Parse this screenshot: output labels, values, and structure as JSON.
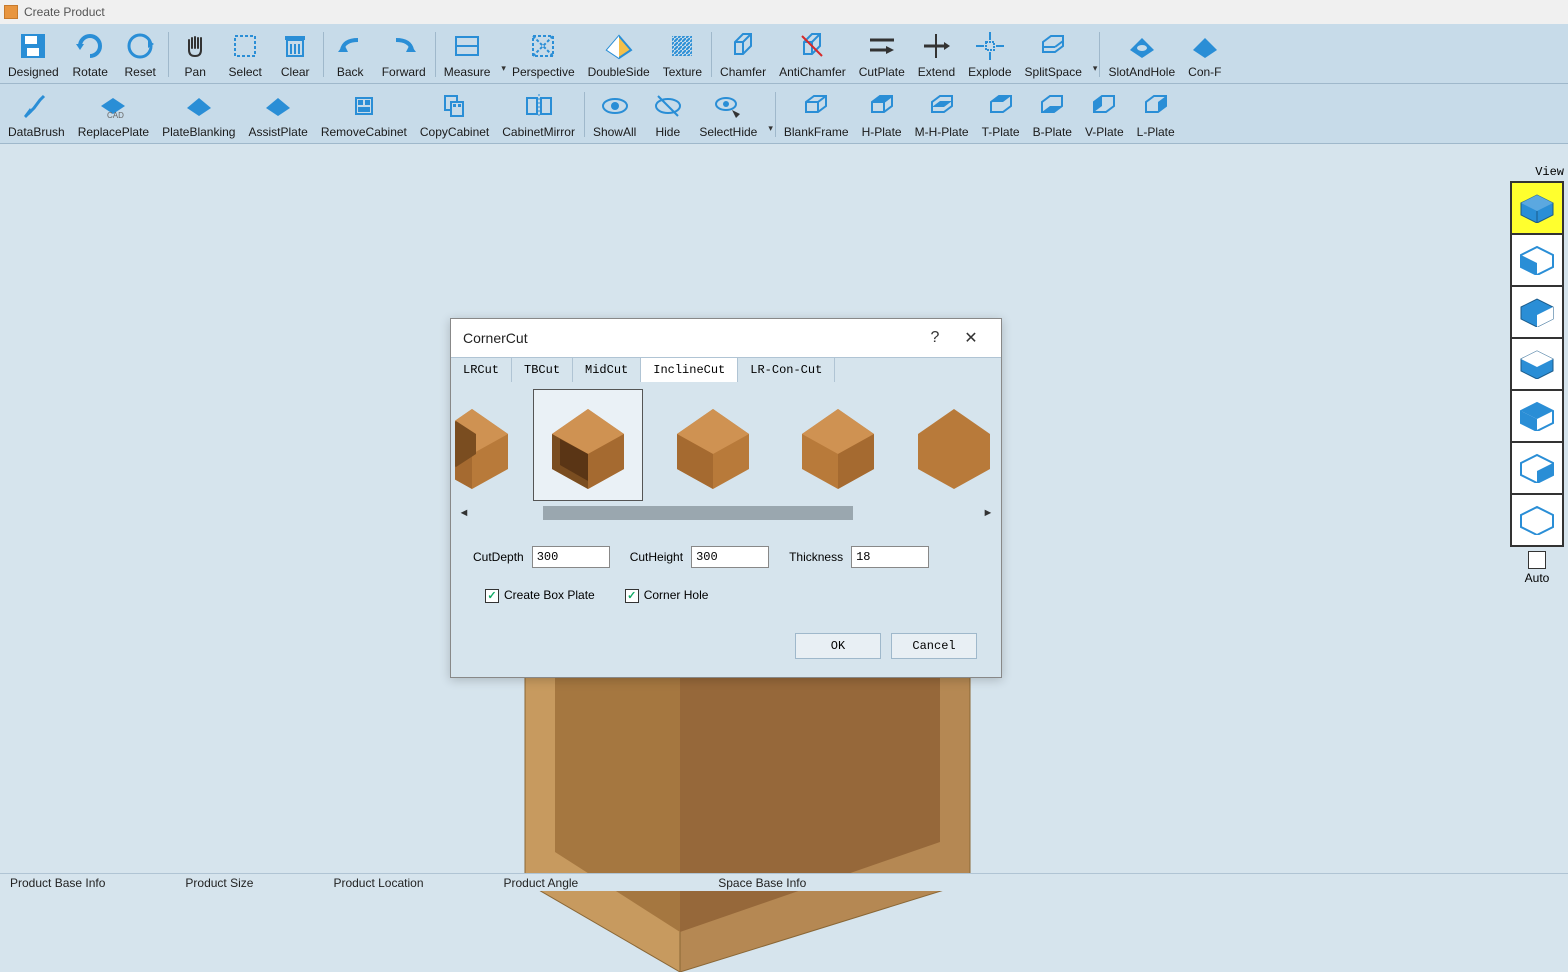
{
  "window": {
    "title": "Create Product"
  },
  "toolbar1": {
    "items": [
      {
        "name": "designed",
        "label": "Designed"
      },
      {
        "name": "rotate",
        "label": "Rotate"
      },
      {
        "name": "reset",
        "label": "Reset"
      },
      {
        "name": "pan",
        "label": "Pan"
      },
      {
        "name": "select",
        "label": "Select"
      },
      {
        "name": "clear",
        "label": "Clear"
      },
      {
        "name": "back",
        "label": "Back"
      },
      {
        "name": "forward",
        "label": "Forward"
      },
      {
        "name": "measure",
        "label": "Measure"
      },
      {
        "name": "perspective",
        "label": "Perspective"
      },
      {
        "name": "doubleside",
        "label": "DoubleSide"
      },
      {
        "name": "texture",
        "label": "Texture"
      },
      {
        "name": "chamfer",
        "label": "Chamfer"
      },
      {
        "name": "antichamfer",
        "label": "AntiChamfer"
      },
      {
        "name": "cutplate",
        "label": "CutPlate"
      },
      {
        "name": "extend",
        "label": "Extend"
      },
      {
        "name": "explode",
        "label": "Explode"
      },
      {
        "name": "splitspace",
        "label": "SplitSpace"
      },
      {
        "name": "slotandhole",
        "label": "SlotAndHole"
      },
      {
        "name": "conf",
        "label": "Con-F"
      }
    ]
  },
  "toolbar2": {
    "items": [
      {
        "name": "databrush",
        "label": "DataBrush"
      },
      {
        "name": "replaceplate",
        "label": "ReplacePlate"
      },
      {
        "name": "plateblanking",
        "label": "PlateBlanking"
      },
      {
        "name": "assistplate",
        "label": "AssistPlate"
      },
      {
        "name": "removecabinet",
        "label": "RemoveCabinet"
      },
      {
        "name": "copycabinet",
        "label": "CopyCabinet"
      },
      {
        "name": "cabinetmirror",
        "label": "CabinetMirror"
      },
      {
        "name": "showall",
        "label": "ShowAll"
      },
      {
        "name": "hide",
        "label": "Hide"
      },
      {
        "name": "selecthide",
        "label": "SelectHide"
      },
      {
        "name": "blankframe",
        "label": "BlankFrame"
      },
      {
        "name": "hplate",
        "label": "H-Plate"
      },
      {
        "name": "mhplate",
        "label": "M-H-Plate"
      },
      {
        "name": "tplate",
        "label": "T-Plate"
      },
      {
        "name": "bplate",
        "label": "B-Plate"
      },
      {
        "name": "vplate",
        "label": "V-Plate"
      },
      {
        "name": "lplate",
        "label": "L-Plate"
      }
    ]
  },
  "view_panel": {
    "title": "View",
    "auto_label": "Auto"
  },
  "dialog": {
    "title": "CornerCut",
    "help": "?",
    "close": "✕",
    "tabs": [
      "LRCut",
      "TBCut",
      "MidCut",
      "InclineCut",
      "LR-Con-Cut"
    ],
    "active_tab": "InclineCut",
    "fields": {
      "cutdepth_label": "CutDepth",
      "cutdepth_value": "300",
      "cutheight_label": "CutHeight",
      "cutheight_value": "300",
      "thickness_label": "Thickness",
      "thickness_value": "18"
    },
    "checks": {
      "createboxplate": "Create Box Plate",
      "cornerhole": "Corner Hole"
    },
    "ok": "OK",
    "cancel": "Cancel"
  },
  "status": {
    "items": [
      "Product Base Info",
      "Product Size",
      "Product Location",
      "Product Angle",
      "Space Base Info"
    ]
  }
}
